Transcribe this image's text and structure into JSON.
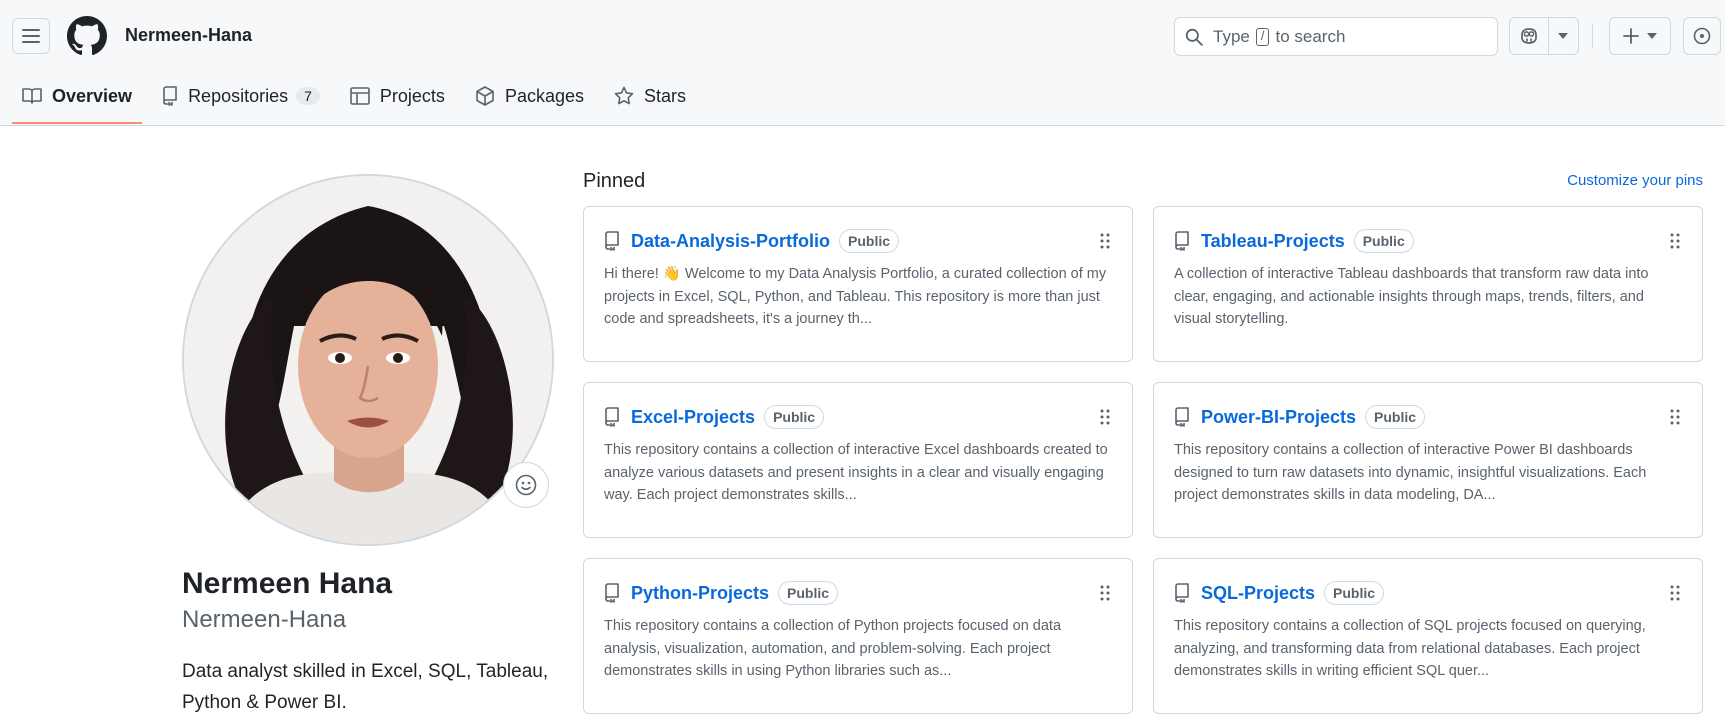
{
  "header": {
    "username": "Nermeen-Hana",
    "search": {
      "prefix": "Type",
      "key": "/",
      "suffix": "to search"
    }
  },
  "tabs": [
    {
      "label": "Overview",
      "icon": "book-icon"
    },
    {
      "label": "Repositories",
      "icon": "repo-icon",
      "count": "7"
    },
    {
      "label": "Projects",
      "icon": "table-icon"
    },
    {
      "label": "Packages",
      "icon": "package-icon"
    },
    {
      "label": "Stars",
      "icon": "star-icon"
    }
  ],
  "profile": {
    "name": "Nermeen Hana",
    "login": "Nermeen-Hana",
    "bio": "Data analyst skilled in Excel, SQL, Tableau, Python & Power BI."
  },
  "pinned": {
    "title": "Pinned",
    "customize": "Customize your pins",
    "repos": [
      {
        "name": "Data-Analysis-Portfolio",
        "visibility": "Public",
        "description": "Hi there! 👋 Welcome to my Data Analysis Portfolio, a curated collection of my projects in Excel, SQL, Python, and Tableau. This repository is more than just code and spreadsheets, it's a journey th..."
      },
      {
        "name": "Tableau-Projects",
        "visibility": "Public",
        "description": "A collection of interactive Tableau dashboards that transform raw data into clear, engaging, and actionable insights through maps, trends, filters, and visual storytelling."
      },
      {
        "name": "Excel-Projects",
        "visibility": "Public",
        "description": "This repository contains a collection of interactive Excel dashboards created to analyze various datasets and present insights in a clear and visually engaging way. Each project demonstrates skills..."
      },
      {
        "name": "Power-BI-Projects",
        "visibility": "Public",
        "description": "This repository contains a collection of interactive Power BI dashboards designed to turn raw datasets into dynamic, insightful visualizations. Each project demonstrates skills in data modeling, DA..."
      },
      {
        "name": "Python-Projects",
        "visibility": "Public",
        "description": "This repository contains a collection of Python projects focused on data analysis, visualization, automation, and problem-solving. Each project demonstrates skills in using Python libraries such as..."
      },
      {
        "name": "SQL-Projects",
        "visibility": "Public",
        "description": "This repository contains a collection of SQL projects focused on querying, analyzing, and transforming data from relational databases. Each project demonstrates skills in writing efficient SQL quer..."
      }
    ]
  },
  "colors": {
    "accent": "#0969da",
    "tab_underline": "#fd8c73",
    "border": "#d1d9e0",
    "muted": "#59636e"
  }
}
